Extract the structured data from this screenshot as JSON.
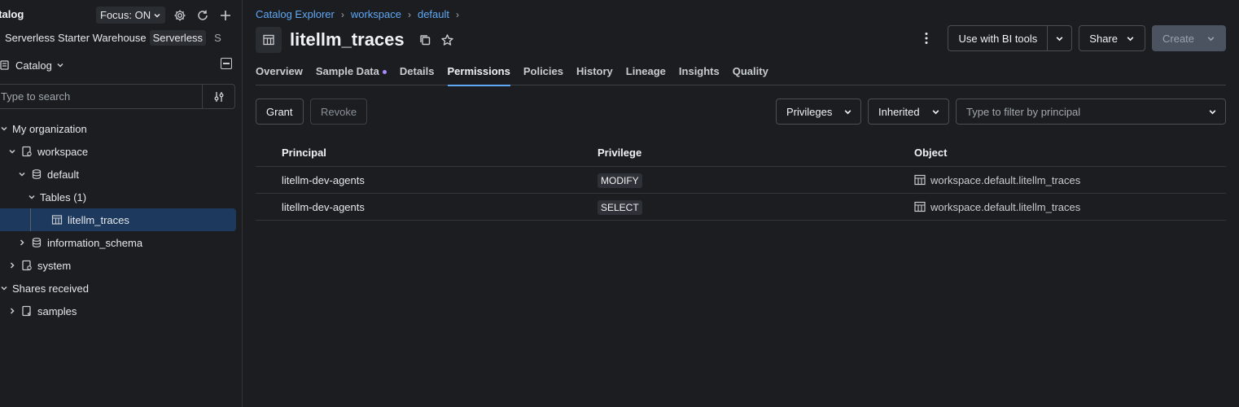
{
  "sidebar": {
    "title": "atalog",
    "focus_label": "Focus: ON",
    "warehouse_name": "Serverless Starter Warehouse",
    "warehouse_badge": "Serverless",
    "warehouse_extra": "S",
    "catalog_selector": "Catalog",
    "search_placeholder": "Type to search",
    "tree": [
      {
        "label": "My organization"
      },
      {
        "label": "workspace"
      },
      {
        "label": "default"
      },
      {
        "label": "Tables (1)"
      },
      {
        "label": "litellm_traces"
      },
      {
        "label": "information_schema"
      },
      {
        "label": "system"
      },
      {
        "label": "Shares received"
      },
      {
        "label": "samples"
      }
    ]
  },
  "breadcrumb": [
    "Catalog Explorer",
    "workspace",
    "default"
  ],
  "header": {
    "title": "litellm_traces",
    "bi_tools_label": "Use with BI tools",
    "share_label": "Share",
    "create_label": "Create"
  },
  "tabs": [
    {
      "label": "Overview"
    },
    {
      "label": "Sample Data"
    },
    {
      "label": "Details"
    },
    {
      "label": "Permissions"
    },
    {
      "label": "Policies"
    },
    {
      "label": "History"
    },
    {
      "label": "Lineage"
    },
    {
      "label": "Insights"
    },
    {
      "label": "Quality"
    }
  ],
  "toolbar": {
    "grant_label": "Grant",
    "revoke_label": "Revoke",
    "privileges_label": "Privileges",
    "inherited_label": "Inherited",
    "principal_filter_placeholder": "Type to filter by principal"
  },
  "grid": {
    "headers": {
      "principal": "Principal",
      "privilege": "Privilege",
      "object": "Object"
    },
    "rows": [
      {
        "principal": "litellm-dev-agents",
        "privilege": "MODIFY",
        "object": "workspace.default.litellm_traces"
      },
      {
        "principal": "litellm-dev-agents",
        "privilege": "SELECT",
        "object": "workspace.default.litellm_traces"
      }
    ]
  },
  "colors": {
    "background": "#1b1d20",
    "accent": "#5fa8f5",
    "selected_row": "#1d3a5e",
    "tab_dot": "#a98bff"
  }
}
